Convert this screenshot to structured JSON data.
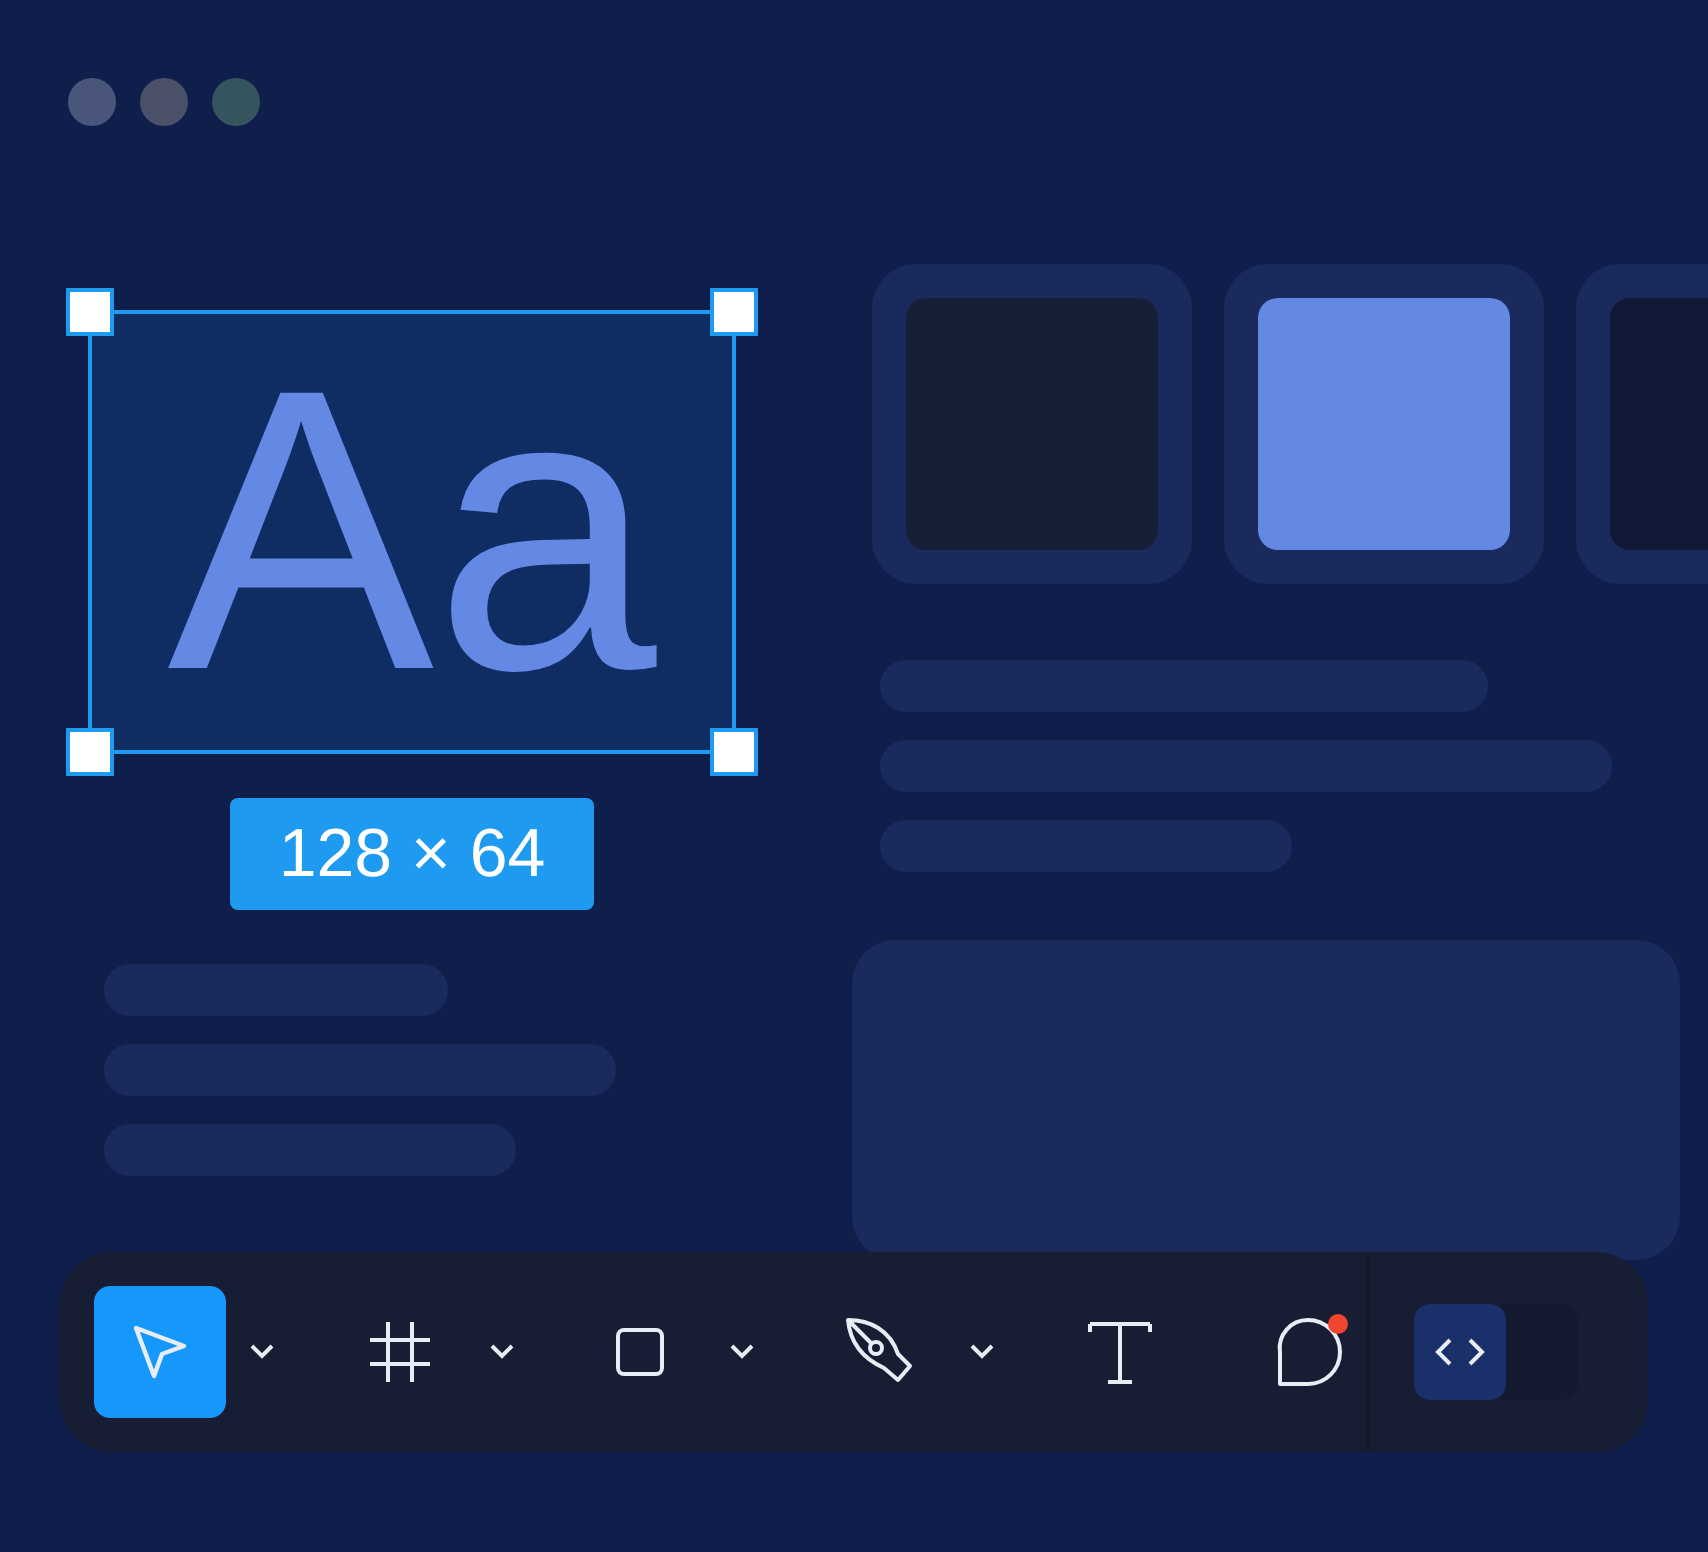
{
  "canvas": {
    "text_layer": {
      "text": "Aa",
      "selected": true
    },
    "dimension_label": "128 × 64"
  },
  "swatches": [
    {
      "color": "#171f36"
    },
    {
      "color": "#6389e5"
    },
    {
      "color": "#111936"
    }
  ],
  "toolbar": {
    "tools": [
      {
        "kind": "select",
        "selected": true,
        "dropdown": true,
        "badge": false
      },
      {
        "kind": "frame",
        "selected": false,
        "dropdown": true,
        "badge": false
      },
      {
        "kind": "rectangle",
        "selected": false,
        "dropdown": true,
        "badge": false
      },
      {
        "kind": "pen",
        "selected": false,
        "dropdown": true,
        "badge": false
      },
      {
        "kind": "text",
        "selected": false,
        "dropdown": false,
        "badge": false
      },
      {
        "kind": "comment",
        "selected": false,
        "dropdown": false,
        "badge": true
      }
    ],
    "code_toggle": {
      "on": true
    }
  }
}
